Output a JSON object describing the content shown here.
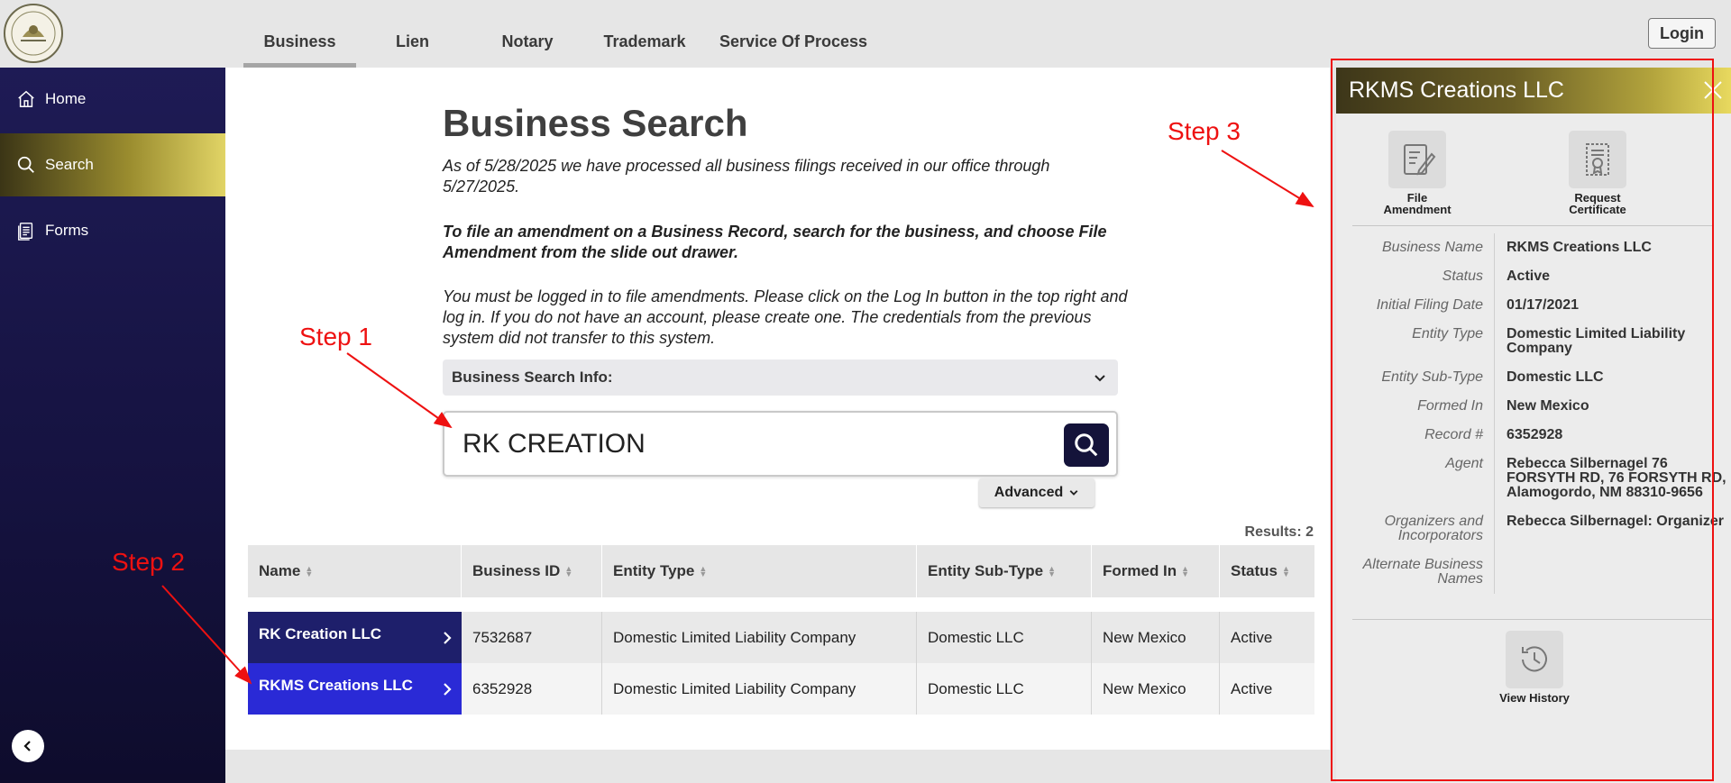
{
  "top_nav": {
    "tabs": [
      {
        "label": "Business",
        "active": true
      },
      {
        "label": "Lien"
      },
      {
        "label": "Notary"
      },
      {
        "label": "Trademark"
      },
      {
        "label": "Service Of Process"
      }
    ],
    "login_label": "Login"
  },
  "sidebar": {
    "items": [
      {
        "label": "Home",
        "icon": "home-icon"
      },
      {
        "label": "Search",
        "icon": "search-icon",
        "active": true
      },
      {
        "label": "Forms",
        "icon": "forms-icon"
      }
    ]
  },
  "main": {
    "title": "Business Search",
    "notice": "As of 5/28/2025 we have processed all business filings received in our office through 5/27/2025.",
    "instruction": "To file an amendment on a Business Record, search for the business, and choose File Amendment from the slide out drawer.",
    "login_notice": "You must be logged in to file amendments. Please click on the Log In button in the top right and log in. If you do not have an account, please create one. The credentials from the previous system did not transfer to this system.",
    "info_label": "Business Search Info:",
    "search_value": "RK CREATION",
    "advanced_label": "Advanced",
    "results_count": "Results: 2"
  },
  "table": {
    "headers": [
      "Name",
      "Business ID",
      "Entity Type",
      "Entity Sub-Type",
      "Formed In",
      "Status"
    ],
    "rows": [
      {
        "name": "RK Creation LLC",
        "id": "7532687",
        "type": "Domestic Limited Liability Company",
        "subtype": "Domestic LLC",
        "formed": "New Mexico",
        "status": "Active"
      },
      {
        "name": "RKMS Creations LLC",
        "id": "6352928",
        "type": "Domestic Limited Liability Company",
        "subtype": "Domestic LLC",
        "formed": "New Mexico",
        "status": "Active"
      }
    ]
  },
  "annotations": {
    "step1": "Step 1",
    "step2": "Step 2",
    "step3": "Step 3"
  },
  "drawer": {
    "title": "RKMS Creations LLC",
    "actions": [
      {
        "label_line1": "File",
        "label_line2": "Amendment",
        "icon": "file-amendment-icon"
      },
      {
        "label_line1": "Request",
        "label_line2": "Certificate",
        "icon": "certificate-icon"
      }
    ],
    "details": [
      {
        "label": "Business Name",
        "value": "RKMS Creations LLC"
      },
      {
        "label": "Status",
        "value": "Active"
      },
      {
        "label": "Initial Filing Date",
        "value": "01/17/2021"
      },
      {
        "label": "Entity Type",
        "value": "Domestic Limited Liability Company"
      },
      {
        "label": "Entity Sub-Type",
        "value": "Domestic LLC"
      },
      {
        "label": "Formed In",
        "value": "New Mexico"
      },
      {
        "label": "Record #",
        "value": "6352928"
      },
      {
        "label": "Agent",
        "value": "Rebecca Silbernagel 76 FORSYTH RD, 76 FORSYTH RD, Alamogordo, NM 88310-9656"
      },
      {
        "label": "Organizers and Incorporators",
        "value": "Rebecca Silbernagel: Organizer"
      },
      {
        "label": "Alternate Business Names",
        "value": ""
      }
    ],
    "history_label": "View History"
  },
  "colors": {
    "sidebar": "#1e1b55",
    "accent_gold": "#e9dc6c",
    "search_button": "#14133a",
    "row_selected": "#2a2ad6",
    "row_name": "#1e1f6b",
    "annotation": "#ee1111"
  }
}
